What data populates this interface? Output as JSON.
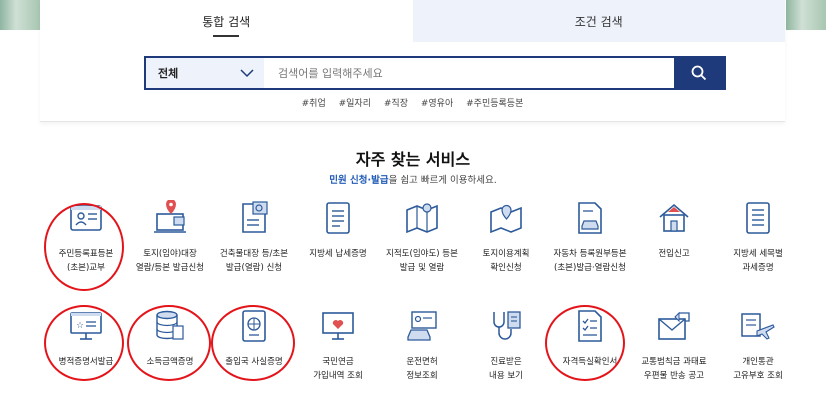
{
  "tabs": [
    {
      "label": "통합 검색",
      "active": true
    },
    {
      "label": "조건 검색",
      "active": false
    }
  ],
  "search": {
    "scope": "전체",
    "placeholder": "검색어를 입력해주세요"
  },
  "tags": [
    "#취업",
    "#일자리",
    "#직장",
    "#영유아",
    "#주민등록등본"
  ],
  "section": {
    "title": "자주 찾는 서비스",
    "subtitle_highlight": "민원 신청·발급",
    "subtitle_rest": "을 쉽고 빠르게 이용하세요."
  },
  "services_row1": [
    {
      "label": "주민등록표등본\n(초본)교부",
      "icon": "resident-card-icon",
      "circled": true
    },
    {
      "label": "토지(임야)대장\n열람/등본 발급신청",
      "icon": "land-map-icon",
      "circled": false
    },
    {
      "label": "건축물대장 등/초본\n발급(열람) 신청",
      "icon": "building-doc-icon",
      "circled": false
    },
    {
      "label": "지방세 납세증명",
      "icon": "tax-doc-icon",
      "circled": false
    },
    {
      "label": "지적도(임야도) 등본\n발급 및 열람",
      "icon": "cadastral-map-icon",
      "circled": false
    },
    {
      "label": "토지이용계획\n확인신청",
      "icon": "land-plan-icon",
      "circled": false
    },
    {
      "label": "자동차 등록원부등본\n(초본)발급·열람신청",
      "icon": "car-register-icon",
      "circled": false
    },
    {
      "label": "전입신고",
      "icon": "move-in-icon",
      "circled": false
    },
    {
      "label": "지방세 세목별\n과세증명",
      "icon": "tax-cert-icon",
      "circled": false
    }
  ],
  "services_row2": [
    {
      "label": "병적증명서발급",
      "icon": "military-monitor-icon",
      "circled": true
    },
    {
      "label": "소득금액증명",
      "icon": "income-coins-icon",
      "circled": true
    },
    {
      "label": "출입국 사실증명",
      "icon": "passport-icon",
      "circled": true
    },
    {
      "label": "국민연금\n가입내역 조회",
      "icon": "pension-icon",
      "circled": false
    },
    {
      "label": "운전면허\n정보조회",
      "icon": "driver-license-icon",
      "circled": false
    },
    {
      "label": "진료받은\n내용 보기",
      "icon": "medical-record-icon",
      "circled": false
    },
    {
      "label": "자격득실확인서",
      "icon": "qualification-doc-icon",
      "circled": true
    },
    {
      "label": "교통범칙금 과태료\n우편물 반송 공고",
      "icon": "traffic-fine-mail-icon",
      "circled": false
    },
    {
      "label": "개인통관\n고유부호 조회",
      "icon": "customs-plane-icon",
      "circled": false
    }
  ],
  "colors": {
    "navy": "#1f3a7a",
    "icon_blue": "#2c5a9a",
    "highlight_blue": "#1f5bb5",
    "circle_red": "#e3141a",
    "tab_bg": "#eef3fb"
  }
}
